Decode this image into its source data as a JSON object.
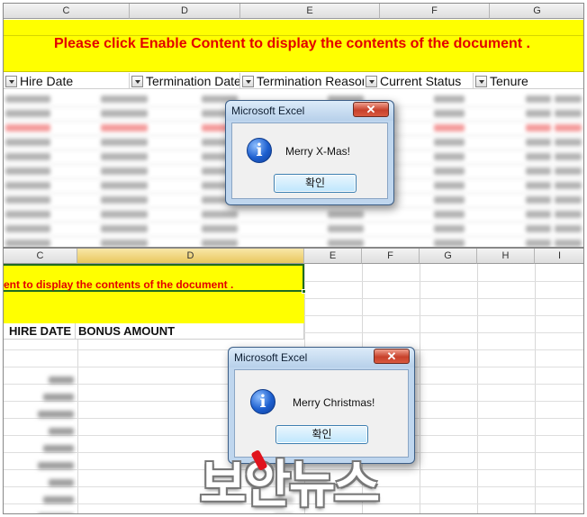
{
  "top_sheet": {
    "columns": [
      "C",
      "D",
      "E",
      "F",
      "G"
    ],
    "banner_text": "Please click Enable Content to display the contents of the document .",
    "filter_headers": [
      "Hire Date",
      "Termination Date",
      "Termination Reason",
      "Current Status",
      "Tenure"
    ]
  },
  "bottom_sheet": {
    "columns": [
      "C",
      "D",
      "E",
      "F",
      "G",
      "H",
      "I"
    ],
    "banner_text": "ent to display the contents of the document .",
    "headers": [
      "HIRE DATE",
      "BONUS AMOUNT"
    ]
  },
  "dialog_top": {
    "title": "Microsoft Excel",
    "close_label": "✕",
    "icon": "info-icon",
    "icon_glyph": "i",
    "message": "Merry X-Mas!",
    "ok_label": "확인"
  },
  "dialog_bottom": {
    "title": "Microsoft Excel",
    "close_label": "✕",
    "icon": "info-icon",
    "icon_glyph": "i",
    "message": "Merry Christmas!",
    "ok_label": "확인"
  },
  "watermark": {
    "text": "보안뉴스"
  },
  "colors": {
    "banner_yellow": "#ffff00",
    "warning_red": "#e30000",
    "selected_column": "#e8c75d",
    "close_button": "#c8412b"
  }
}
